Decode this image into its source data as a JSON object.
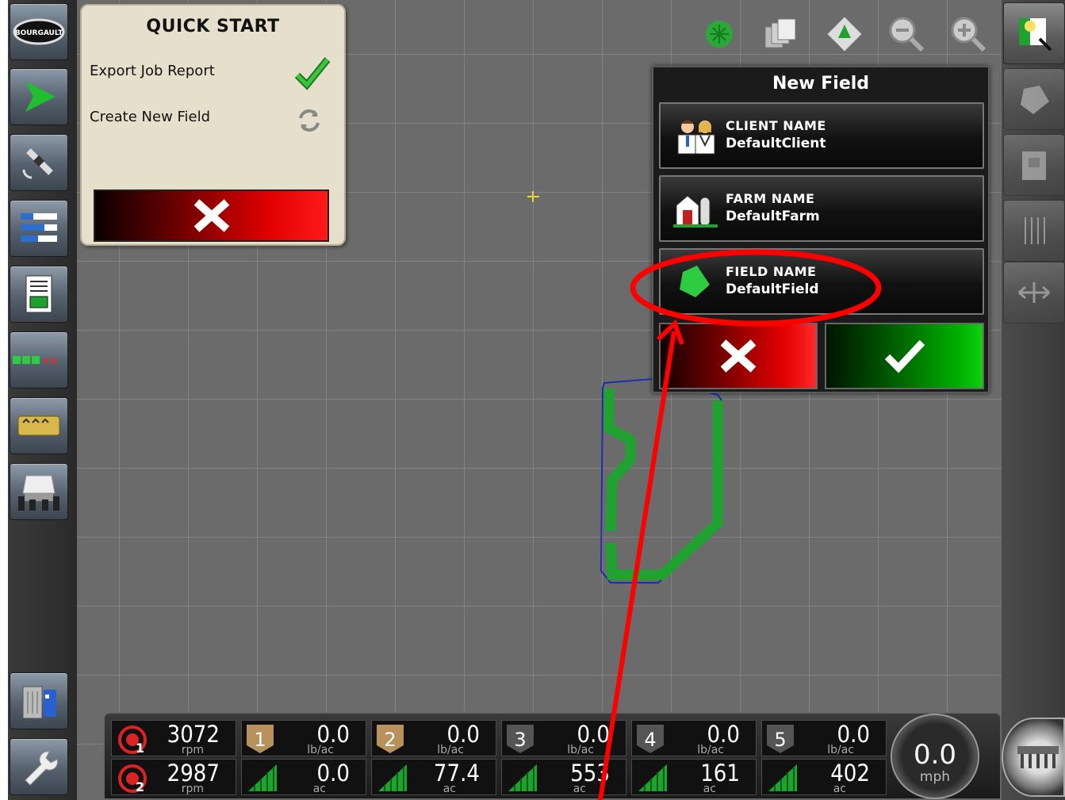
{
  "quick_start": {
    "title": "QUICK START",
    "items": [
      {
        "label": "Export Job Report",
        "status_icon": "check-icon"
      },
      {
        "label": "Create New Field",
        "status_icon": "refresh-icon"
      }
    ]
  },
  "new_field": {
    "title": "New Field",
    "rows": [
      {
        "label": "CLIENT NAME",
        "value": "DefaultClient",
        "icon": "client-icon"
      },
      {
        "label": "FARM NAME",
        "value": "DefaultFarm",
        "icon": "farm-icon"
      },
      {
        "label": "FIELD NAME",
        "value": "DefaultField",
        "icon": "field-icon"
      }
    ]
  },
  "status": {
    "engines": [
      {
        "number": "1",
        "value": "3072",
        "unit": "rpm"
      },
      {
        "number": "2",
        "value": "2987",
        "unit": "rpm"
      }
    ],
    "sections": [
      {
        "number": "1",
        "rate": "0.0",
        "rate_unit": "lb/ac",
        "area": "0.0",
        "area_unit": "ac"
      },
      {
        "number": "2",
        "rate": "0.0",
        "rate_unit": "lb/ac",
        "area": "77.4",
        "area_unit": "ac"
      },
      {
        "number": "3",
        "rate": "0.0",
        "rate_unit": "lb/ac",
        "area": "553",
        "area_unit": "ac"
      },
      {
        "number": "4",
        "rate": "0.0",
        "rate_unit": "lb/ac",
        "area": "161",
        "area_unit": "ac"
      },
      {
        "number": "5",
        "rate": "0.0",
        "rate_unit": "lb/ac",
        "area": "402",
        "area_unit": "ac"
      }
    ],
    "speed": {
      "value": "0.0",
      "unit": "mph"
    }
  },
  "left_toolbar": [
    "bourgault-logo",
    "guidance-play-icon",
    "satellite-icon",
    "bars-icon",
    "report-icon",
    "sections-icon",
    "tank-icon",
    "implement-icon",
    "trash-icon",
    "wrench-icon"
  ],
  "brand": {
    "logo_text": "BOURGAULT"
  },
  "colors": {
    "accent_green": "#1fa22f",
    "danger_red": "#e00000",
    "map_gray": "#6b6b6b",
    "annotation_red": "#ff0000"
  }
}
